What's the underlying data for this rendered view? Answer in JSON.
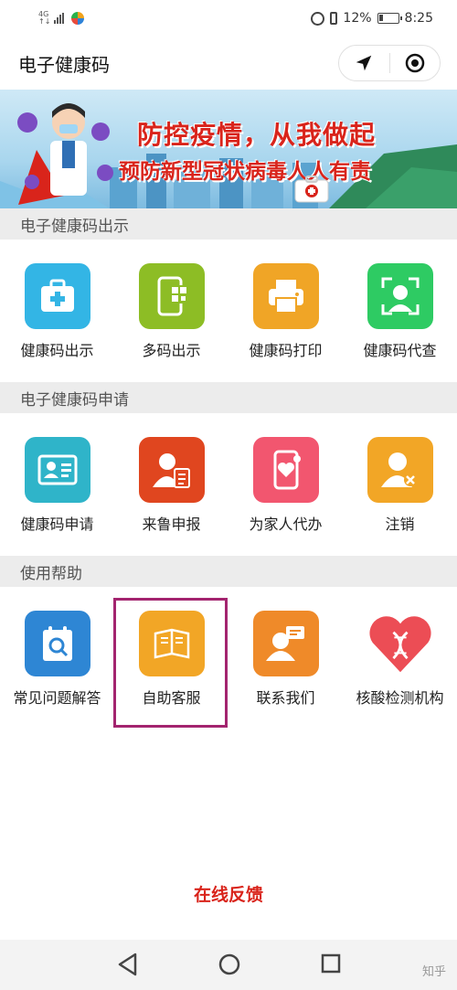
{
  "status_bar": {
    "network": "4G",
    "battery": "12%",
    "time": "8:25"
  },
  "header": {
    "title": "电子健康码"
  },
  "banner": {
    "line1": "防控疫情，从我做起",
    "line2": "预防新型冠状病毒人人有责"
  },
  "sections": [
    {
      "title": "电子健康码出示",
      "items": [
        {
          "label": "健康码出示",
          "icon": "medical-kit-icon",
          "color": "#33b5e5"
        },
        {
          "label": "多码出示",
          "icon": "phone-qr-icon",
          "color": "#8dbd25"
        },
        {
          "label": "健康码打印",
          "icon": "printer-icon",
          "color": "#f0a526"
        },
        {
          "label": "健康码代查",
          "icon": "face-scan-icon",
          "color": "#2ecb63"
        }
      ]
    },
    {
      "title": "电子健康码申请",
      "items": [
        {
          "label": "健康码申请",
          "icon": "id-card-icon",
          "color": "#2fb4c9"
        },
        {
          "label": "来鲁申报",
          "icon": "user-document-icon",
          "color": "#e0461f"
        },
        {
          "label": "为家人代办",
          "icon": "phone-heart-icon",
          "color": "#f2566f"
        },
        {
          "label": "注销",
          "icon": "user-remove-icon",
          "color": "#f2a626"
        }
      ]
    },
    {
      "title": "使用帮助",
      "items": [
        {
          "label": "常见问题解答",
          "icon": "faq-search-icon",
          "color": "#2e86d4"
        },
        {
          "label": "自助客服",
          "icon": "self-service-icon",
          "color": "#f2a626"
        },
        {
          "label": "联系我们",
          "icon": "contact-chat-icon",
          "color": "#ef8a29"
        },
        {
          "label": "核酸检测机构",
          "icon": "dna-heart-icon",
          "color": "#ec4d55"
        }
      ]
    }
  ],
  "footer": {
    "feedback_label": "在线反馈"
  },
  "watermark": "知乎"
}
